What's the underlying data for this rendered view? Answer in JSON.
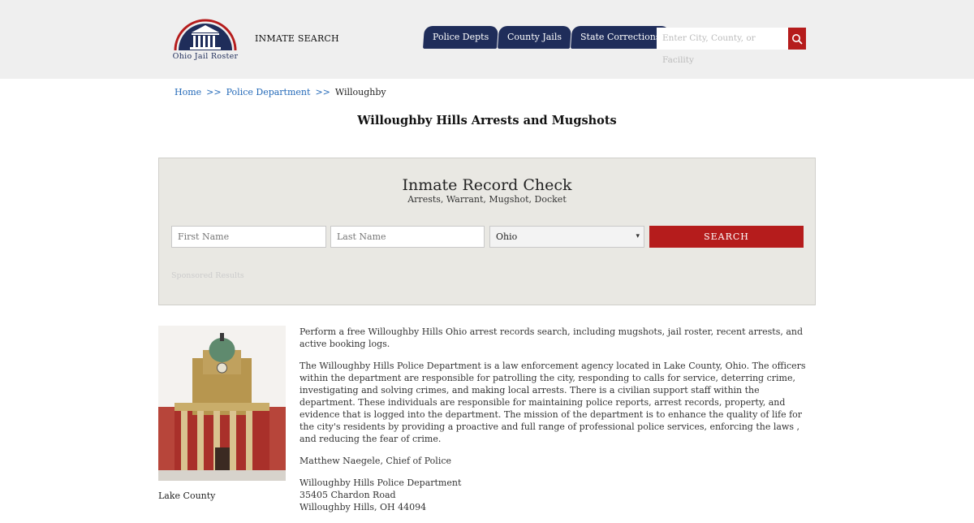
{
  "header": {
    "logo_text": "Ohio Jail Roster",
    "inmate_search": "INMATE SEARCH",
    "tabs": [
      {
        "label": "Police Depts"
      },
      {
        "label": "County Jails"
      },
      {
        "label": "State Corrections"
      }
    ],
    "search_placeholder": "Enter City, County, or Facility"
  },
  "breadcrumb": {
    "home": "Home",
    "sep": ">>",
    "police": "Police Department",
    "current": "Willoughby"
  },
  "page_title": "Willoughby Hills Arrests and Mugshots",
  "record_check": {
    "title": "Inmate Record Check",
    "subtitle": "Arrests, Warrant, Mugshot, Docket",
    "first_name_placeholder": "First Name",
    "last_name_placeholder": "Last Name",
    "state_selected": "Ohio",
    "search_label": "SEARCH",
    "sponsored": "Sponsored Results"
  },
  "content": {
    "photo_caption": "Lake County",
    "paragraph1": "Perform a free Willoughby Hills Ohio arrest records search, including mugshots, jail roster, recent arrests, and active booking logs.",
    "paragraph2": "The Willoughby Hills Police Department is a law enforcement agency located in Lake County, Ohio. The officers within the department are responsible for patrolling the city, responding to calls for service, deterring crime, investigating and solving crimes, and making local arrests. There is a civilian support staff within the department. These individuals are responsible for maintaining police reports, arrest records, property, and evidence that is logged into the department. The mission of the department is to enhance the quality of life for the city's residents by providing a proactive and full range of professional police services, enforcing the laws , and reducing the fear of crime.",
    "chief": "Matthew Naegele, Chief of Police",
    "address_name": "Willoughby Hills Police Department",
    "address_street": "35405 Chardon Road",
    "address_city": "Willoughby Hills, OH 44094"
  },
  "colors": {
    "navy": "#1f2d5a",
    "red": "#b51c1c",
    "link": "#2369b8"
  }
}
